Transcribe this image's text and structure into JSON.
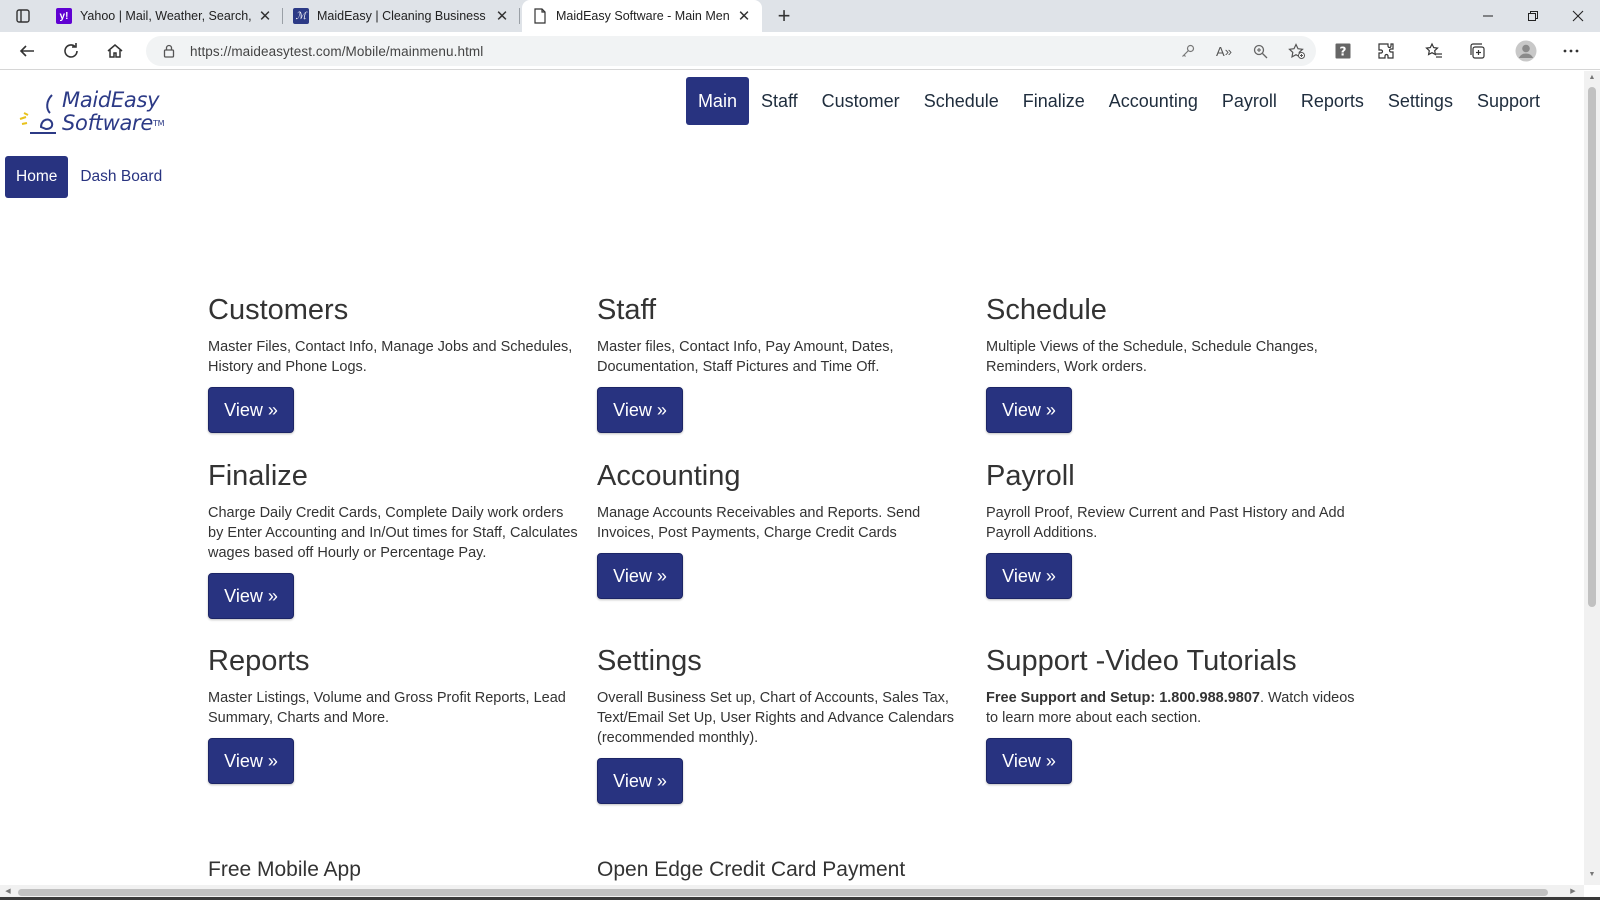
{
  "browser": {
    "tabs": [
      {
        "title": "Yahoo | Mail, Weather, Search, Po",
        "favicon": "yahoo-favicon",
        "active": false
      },
      {
        "title": "MaidEasy | Cleaning Business Sof",
        "favicon": "maideasy-favicon",
        "active": false
      },
      {
        "title": "MaidEasy Software - Main Menu",
        "favicon": "page-favicon",
        "active": true
      }
    ],
    "url": "https://maideasytest.com/Mobile/mainmenu.html"
  },
  "logo": {
    "line1": "MaidEasy",
    "line2": "Software",
    "tm": "TM"
  },
  "topnav": {
    "items": [
      "Main",
      "Staff",
      "Customer",
      "Schedule",
      "Finalize",
      "Accounting",
      "Payroll",
      "Reports",
      "Settings",
      "Support"
    ],
    "active": "Main"
  },
  "subnav": {
    "home": "Home",
    "dashboard": "Dash Board"
  },
  "sections": [
    {
      "title": "Customers",
      "desc": "Master Files, Contact Info, Manage Jobs and Schedules, History and Phone Logs.",
      "button": "View »"
    },
    {
      "title": "Staff",
      "desc": "Master files, Contact Info, Pay Amount, Dates, Documentation, Staff Pictures and Time Off.",
      "button": "View »"
    },
    {
      "title": "Schedule",
      "desc": "Multiple Views of the Schedule, Schedule Changes, Reminders, Work orders.",
      "button": "View »"
    },
    {
      "title": "Finalize",
      "desc": "Charge Daily Credit Cards, Complete Daily work orders by Enter Accounting and In/Out times for Staff, Calculates wages based off Hourly or Percentage Pay.",
      "button": "View »"
    },
    {
      "title": "Accounting",
      "desc": "Manage Accounts Receivables and Reports. Send Invoices, Post Payments, Charge Credit Cards",
      "button": "View »"
    },
    {
      "title": "Payroll",
      "desc": "Payroll Proof, Review Current and Past History and Add Payroll Additions.",
      "button": "View »"
    },
    {
      "title": "Reports",
      "desc": "Master Listings, Volume and Gross Profit Reports, Lead Summary, Charts and More.",
      "button": "View »"
    },
    {
      "title": "Settings",
      "desc": "Overall Business Set up, Chart of Accounts, Sales Tax, Text/Email Set Up, User Rights and Advance Calendars (recommended monthly).",
      "button": "View »"
    },
    {
      "title": "Support -Video Tutorials",
      "desc_bold": "Free Support and Setup: 1.800.988.9807",
      "desc": ". Watch videos to learn more about each section.",
      "button": "View »"
    }
  ],
  "cut_off_headings": [
    "Free Mobile App",
    "Open Edge Credit Card Payment"
  ],
  "colors": {
    "brand": "#283380",
    "chrome": "#dfe3e8"
  }
}
